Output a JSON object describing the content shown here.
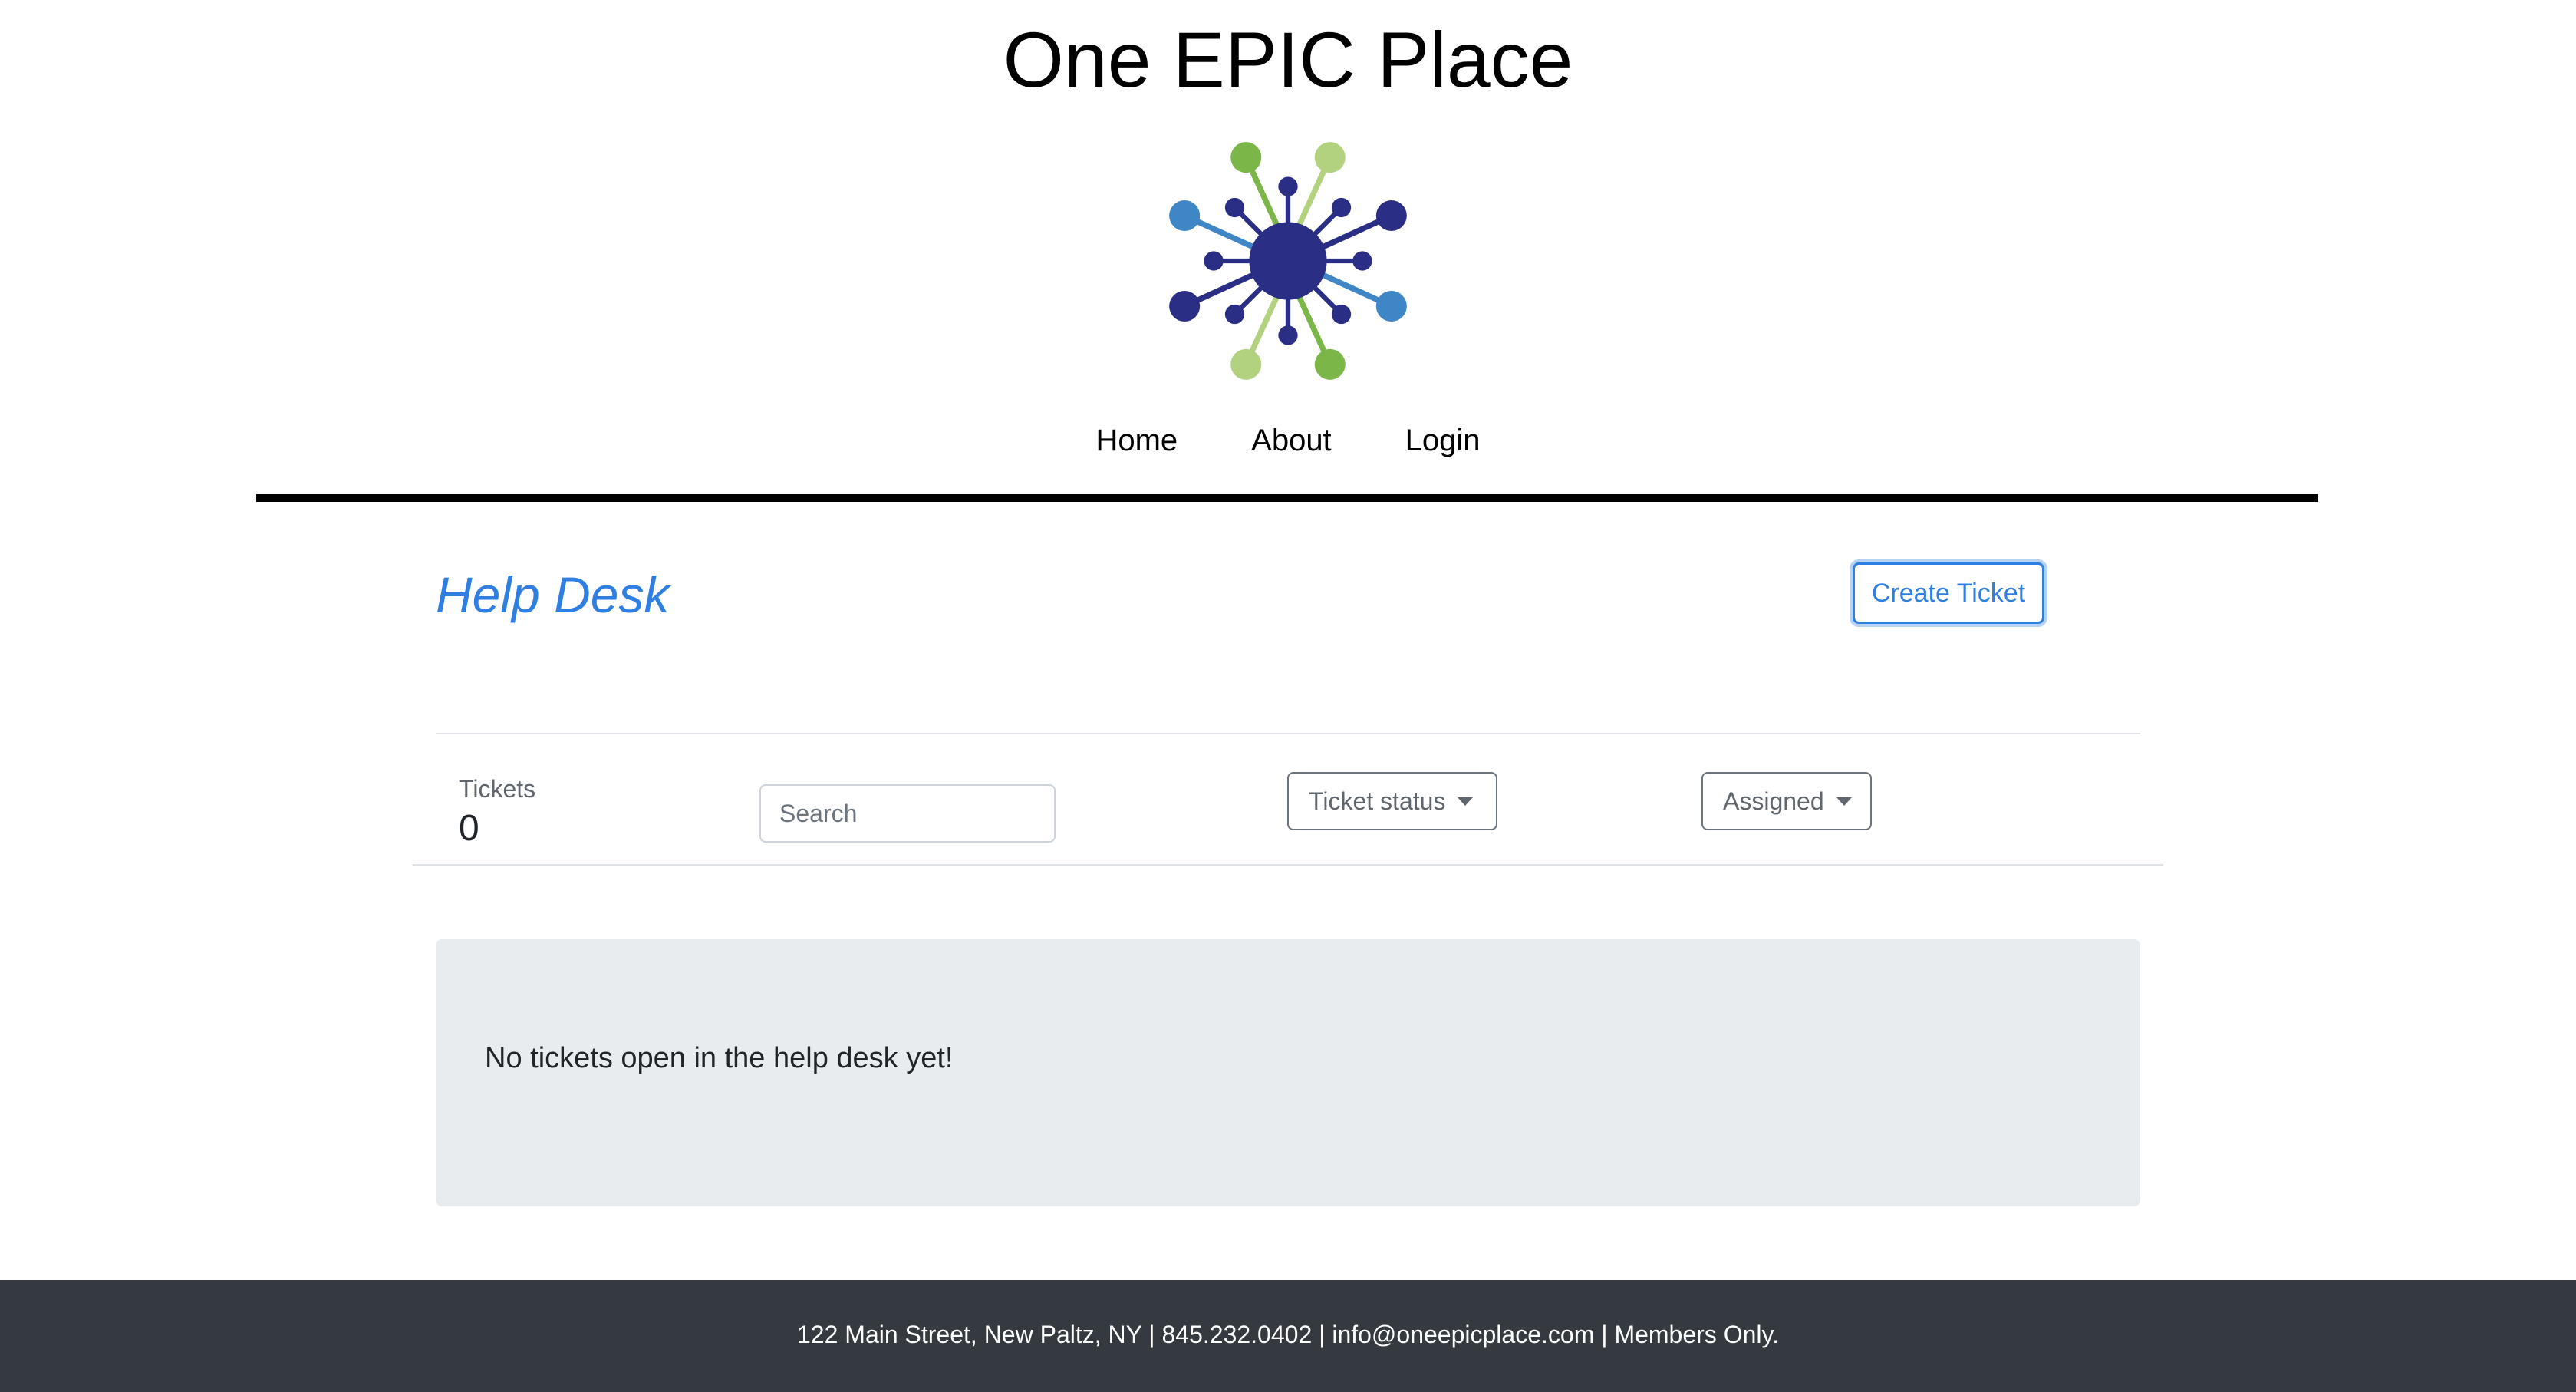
{
  "header": {
    "site_title": "One EPIC Place"
  },
  "nav": {
    "items": [
      "Home",
      "About",
      "Login"
    ]
  },
  "helpdesk": {
    "title": "Help Desk",
    "create_button": "Create Ticket",
    "tickets_label": "Tickets",
    "tickets_count": "0",
    "search_placeholder": "Search",
    "status_dropdown": "Ticket status",
    "assigned_dropdown": "Assigned",
    "empty_message": "No tickets open in the help desk yet!"
  },
  "footer": {
    "text": "122 Main Street, New Paltz, NY | 845.232.0402 | info@oneepicplace.com | Members Only."
  },
  "colors": {
    "accent": "#2f7fe3",
    "logo_navy": "#2a2f85",
    "logo_green": "#7ab648",
    "logo_light_green": "#b3d27f",
    "logo_blue": "#3f86c7",
    "footer_bg": "#343a40",
    "empty_box_bg": "#e9ecef"
  }
}
